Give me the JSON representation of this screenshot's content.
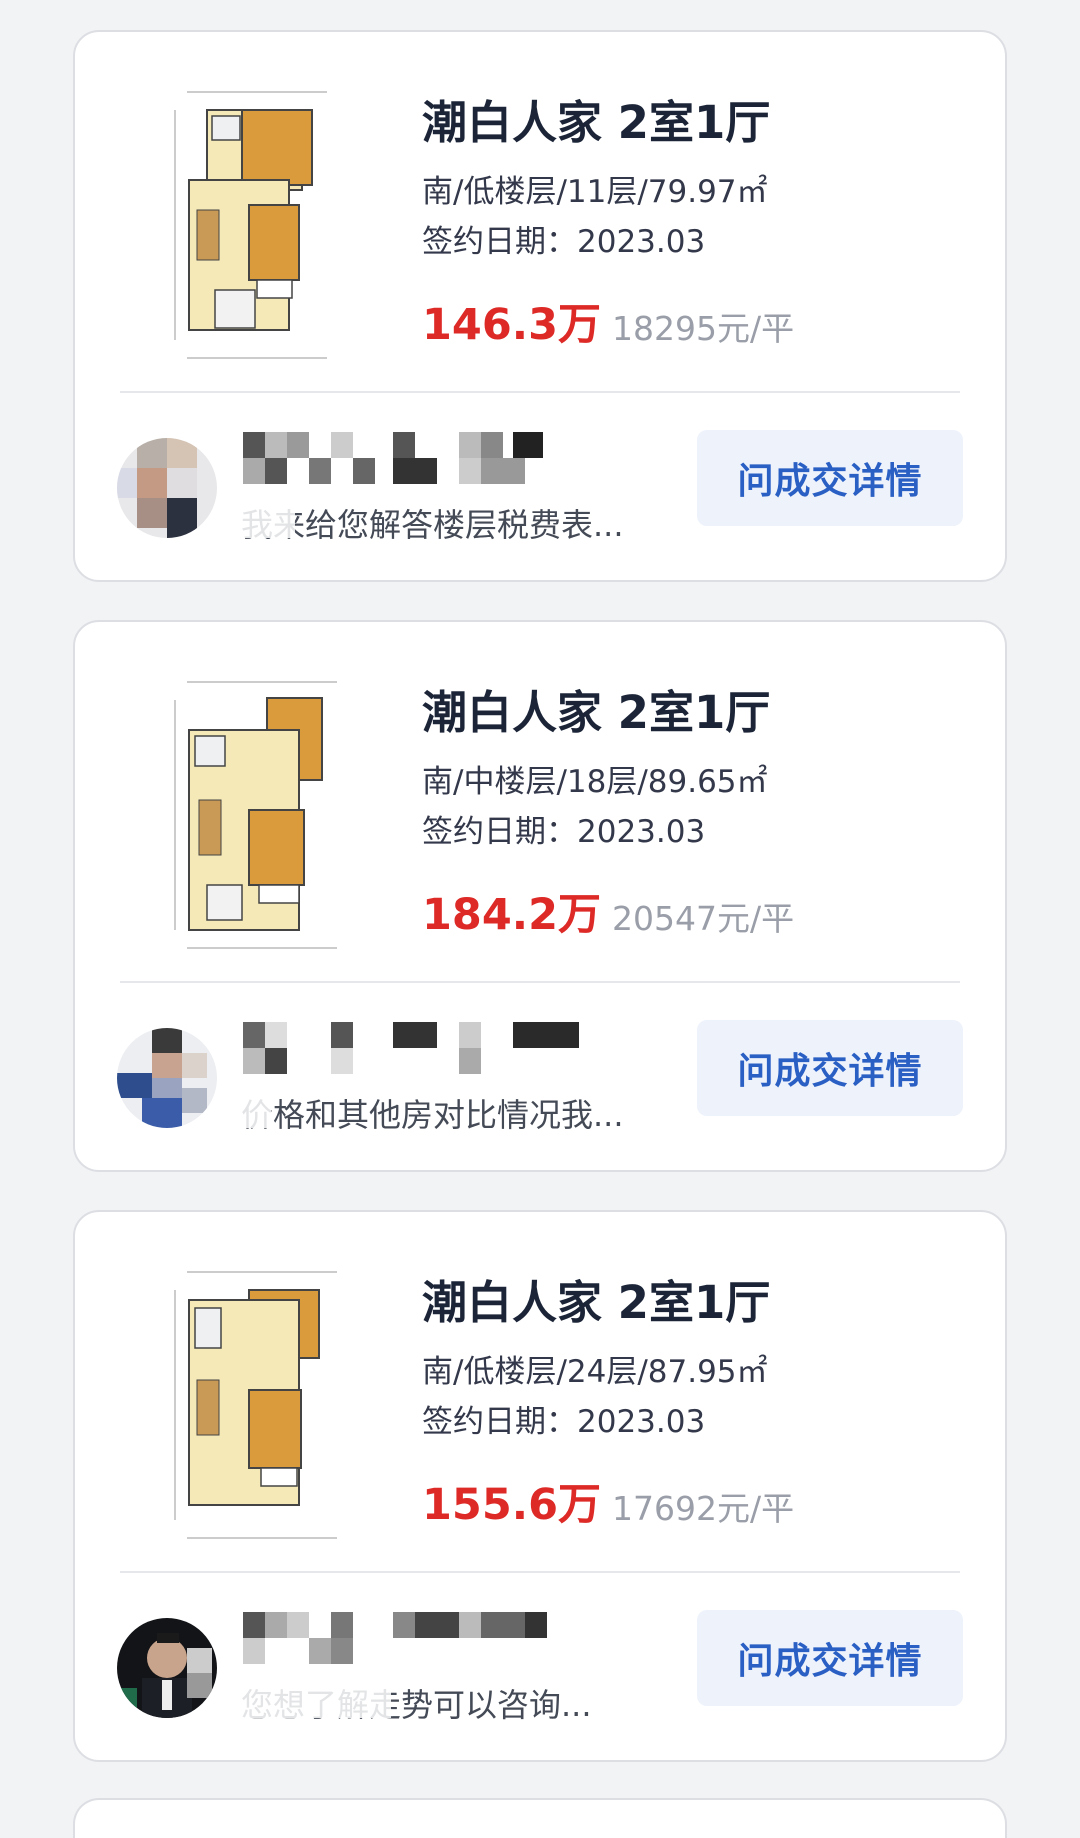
{
  "listings": [
    {
      "title": "潮白人家 2室1厅",
      "info": "南/低楼层/11层/79.97㎡",
      "date": "签约日期：2023.03",
      "price": "146.3万",
      "unit_price": "18295元/平",
      "agent_message": "我来给您解答楼层税费表...",
      "button": "问成交详情"
    },
    {
      "title": "潮白人家 2室1厅",
      "info": "南/中楼层/18层/89.65㎡",
      "date": "签约日期：2023.03",
      "price": "184.2万",
      "unit_price": "20547元/平",
      "agent_message": "价格和其他房对比情况我...",
      "button": "问成交详情"
    },
    {
      "title": "潮白人家 2室1厅",
      "info": "南/低楼层/24层/87.95㎡",
      "date": "签约日期：2023.03",
      "price": "155.6万",
      "unit_price": "17692元/平",
      "agent_message": "您想了解走势可以咨询...",
      "button": "问成交详情"
    }
  ],
  "colors": {
    "price": "#dd2a27",
    "title": "#1c2538",
    "button_bg": "#edf2fb",
    "button_text": "#2a5fc4"
  }
}
